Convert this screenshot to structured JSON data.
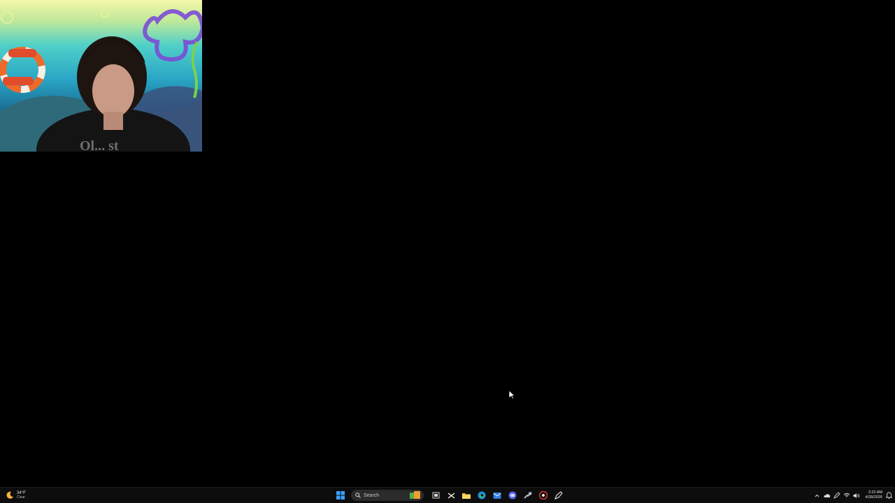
{
  "taskbar": {
    "weather": {
      "temperature": "34°F",
      "condition": "Clear",
      "icon": "weather-moon-icon"
    },
    "search": {
      "placeholder": "Search",
      "icon": "search-icon"
    },
    "pinned_apps": [
      {
        "name": "start-button",
        "icon": "windows-logo-icon"
      },
      {
        "name": "task-view",
        "icon": "task-view-icon"
      },
      {
        "name": "capcut",
        "icon": "capcut-icon"
      },
      {
        "name": "file-explorer",
        "icon": "folder-icon"
      },
      {
        "name": "edge",
        "icon": "edge-icon"
      },
      {
        "name": "mail",
        "icon": "mail-icon"
      },
      {
        "name": "discord",
        "icon": "discord-icon"
      },
      {
        "name": "steam",
        "icon": "steam-icon"
      },
      {
        "name": "chrome-like",
        "icon": "browser-icon"
      },
      {
        "name": "paint",
        "icon": "pen-icon"
      }
    ],
    "tray": {
      "chevron_icon": "chevron-up-icon",
      "cloud_icon": "onedrive-cloud-icon",
      "pen_icon": "pen-tray-icon",
      "wifi_icon": "wifi-icon",
      "volume_icon": "volume-icon",
      "time": "2:22 AM",
      "date": "4/28/2026",
      "notification_icon": "notification-icon"
    }
  },
  "webcam": {
    "shirt_text": "Ol... st"
  },
  "colors": {
    "taskbar_bg": "#0d0d0d",
    "desktop_bg": "#000000",
    "accent_blue": "#3aa0ff"
  }
}
